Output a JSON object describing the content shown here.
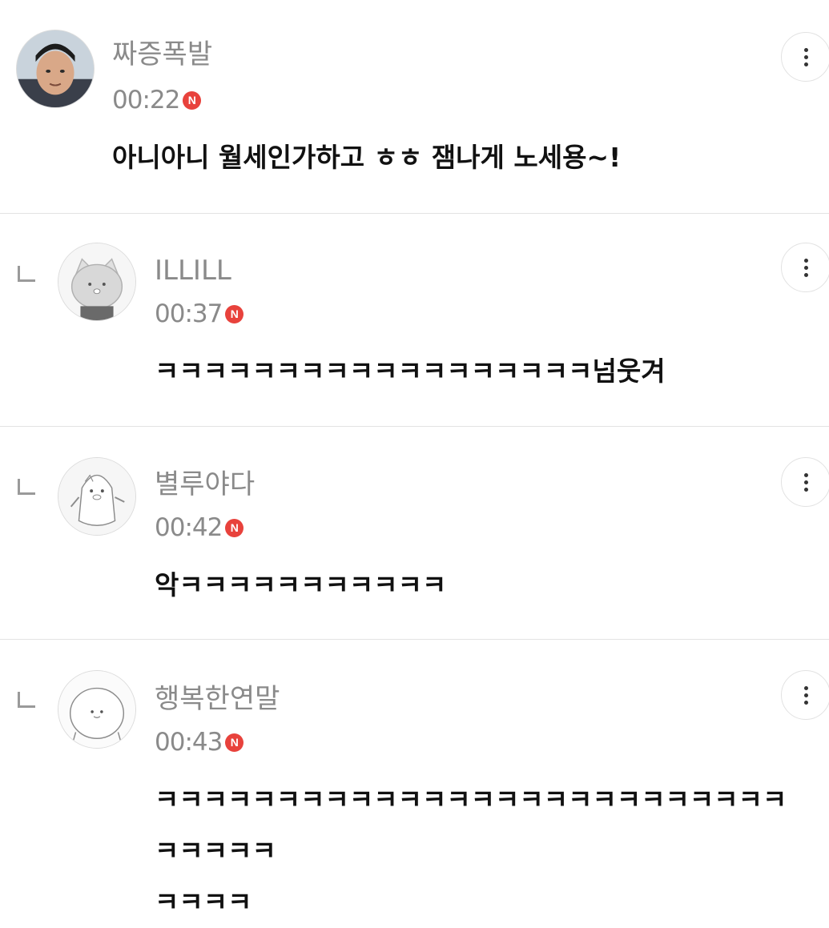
{
  "comments": [
    {
      "username": "짜증폭발",
      "time": "00:22",
      "badge": "N",
      "message": "아니아니 월세인가하고 ㅎㅎ 잼나게 노세용~!",
      "is_reply": false
    },
    {
      "username": "ILLILL",
      "time": "00:37",
      "badge": "N",
      "message": "ㅋㅋㅋㅋㅋㅋㅋㅋㅋㅋㅋㅋㅋㅋㅋㅋㅋㅋ넘웃겨",
      "is_reply": true
    },
    {
      "username": "별루야다",
      "time": "00:42",
      "badge": "N",
      "message": "악ㅋㅋㅋㅋㅋㅋㅋㅋㅋㅋㅋ",
      "is_reply": true
    },
    {
      "username": "행복한연말",
      "time": "00:43",
      "badge": "N",
      "message": "ㅋㅋㅋㅋㅋㅋㅋㅋㅋㅋㅋㅋㅋㅋㅋㅋㅋㅋㅋㅋㅋㅋㅋㅋㅋㅋㅋㅋㅋㅋㅋ\nㅋㅋㅋㅋ",
      "is_reply": true
    }
  ],
  "icons": {
    "reply": "reply-arrow-icon",
    "menu": "more-vertical-icon",
    "new": "new-badge-icon"
  },
  "colors": {
    "username": "#8a8a8a",
    "badge": "#e8423c",
    "divider": "#e3e3e3",
    "message": "#111111"
  }
}
